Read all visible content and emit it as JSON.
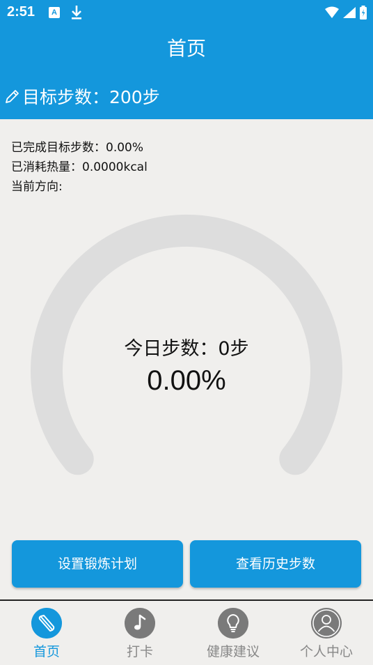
{
  "status_bar": {
    "time": "2:51",
    "a_badge": "A"
  },
  "header": {
    "title": "首页"
  },
  "goal": {
    "text": "目标步数：200步"
  },
  "stats": {
    "completed": "已完成目标步数：0.00%",
    "calories": "已消耗热量：0.0000kcal",
    "direction": "当前方向:"
  },
  "gauge": {
    "steps_text": "今日步数：0步",
    "percent_text": "0.00%",
    "progress": 0.0
  },
  "buttons": {
    "plan": "设置锻炼计划",
    "history": "查看历史步数"
  },
  "nav": {
    "items": [
      {
        "label": "首页",
        "icon": "shoe-icon",
        "active": true
      },
      {
        "label": "打卡",
        "icon": "music-note-icon",
        "active": false
      },
      {
        "label": "健康建议",
        "icon": "lightbulb-icon",
        "active": false
      },
      {
        "label": "个人中心",
        "icon": "person-icon",
        "active": false
      }
    ]
  },
  "colors": {
    "primary": "#1497dc",
    "track": "#dddddd",
    "background": "#f0efed"
  }
}
